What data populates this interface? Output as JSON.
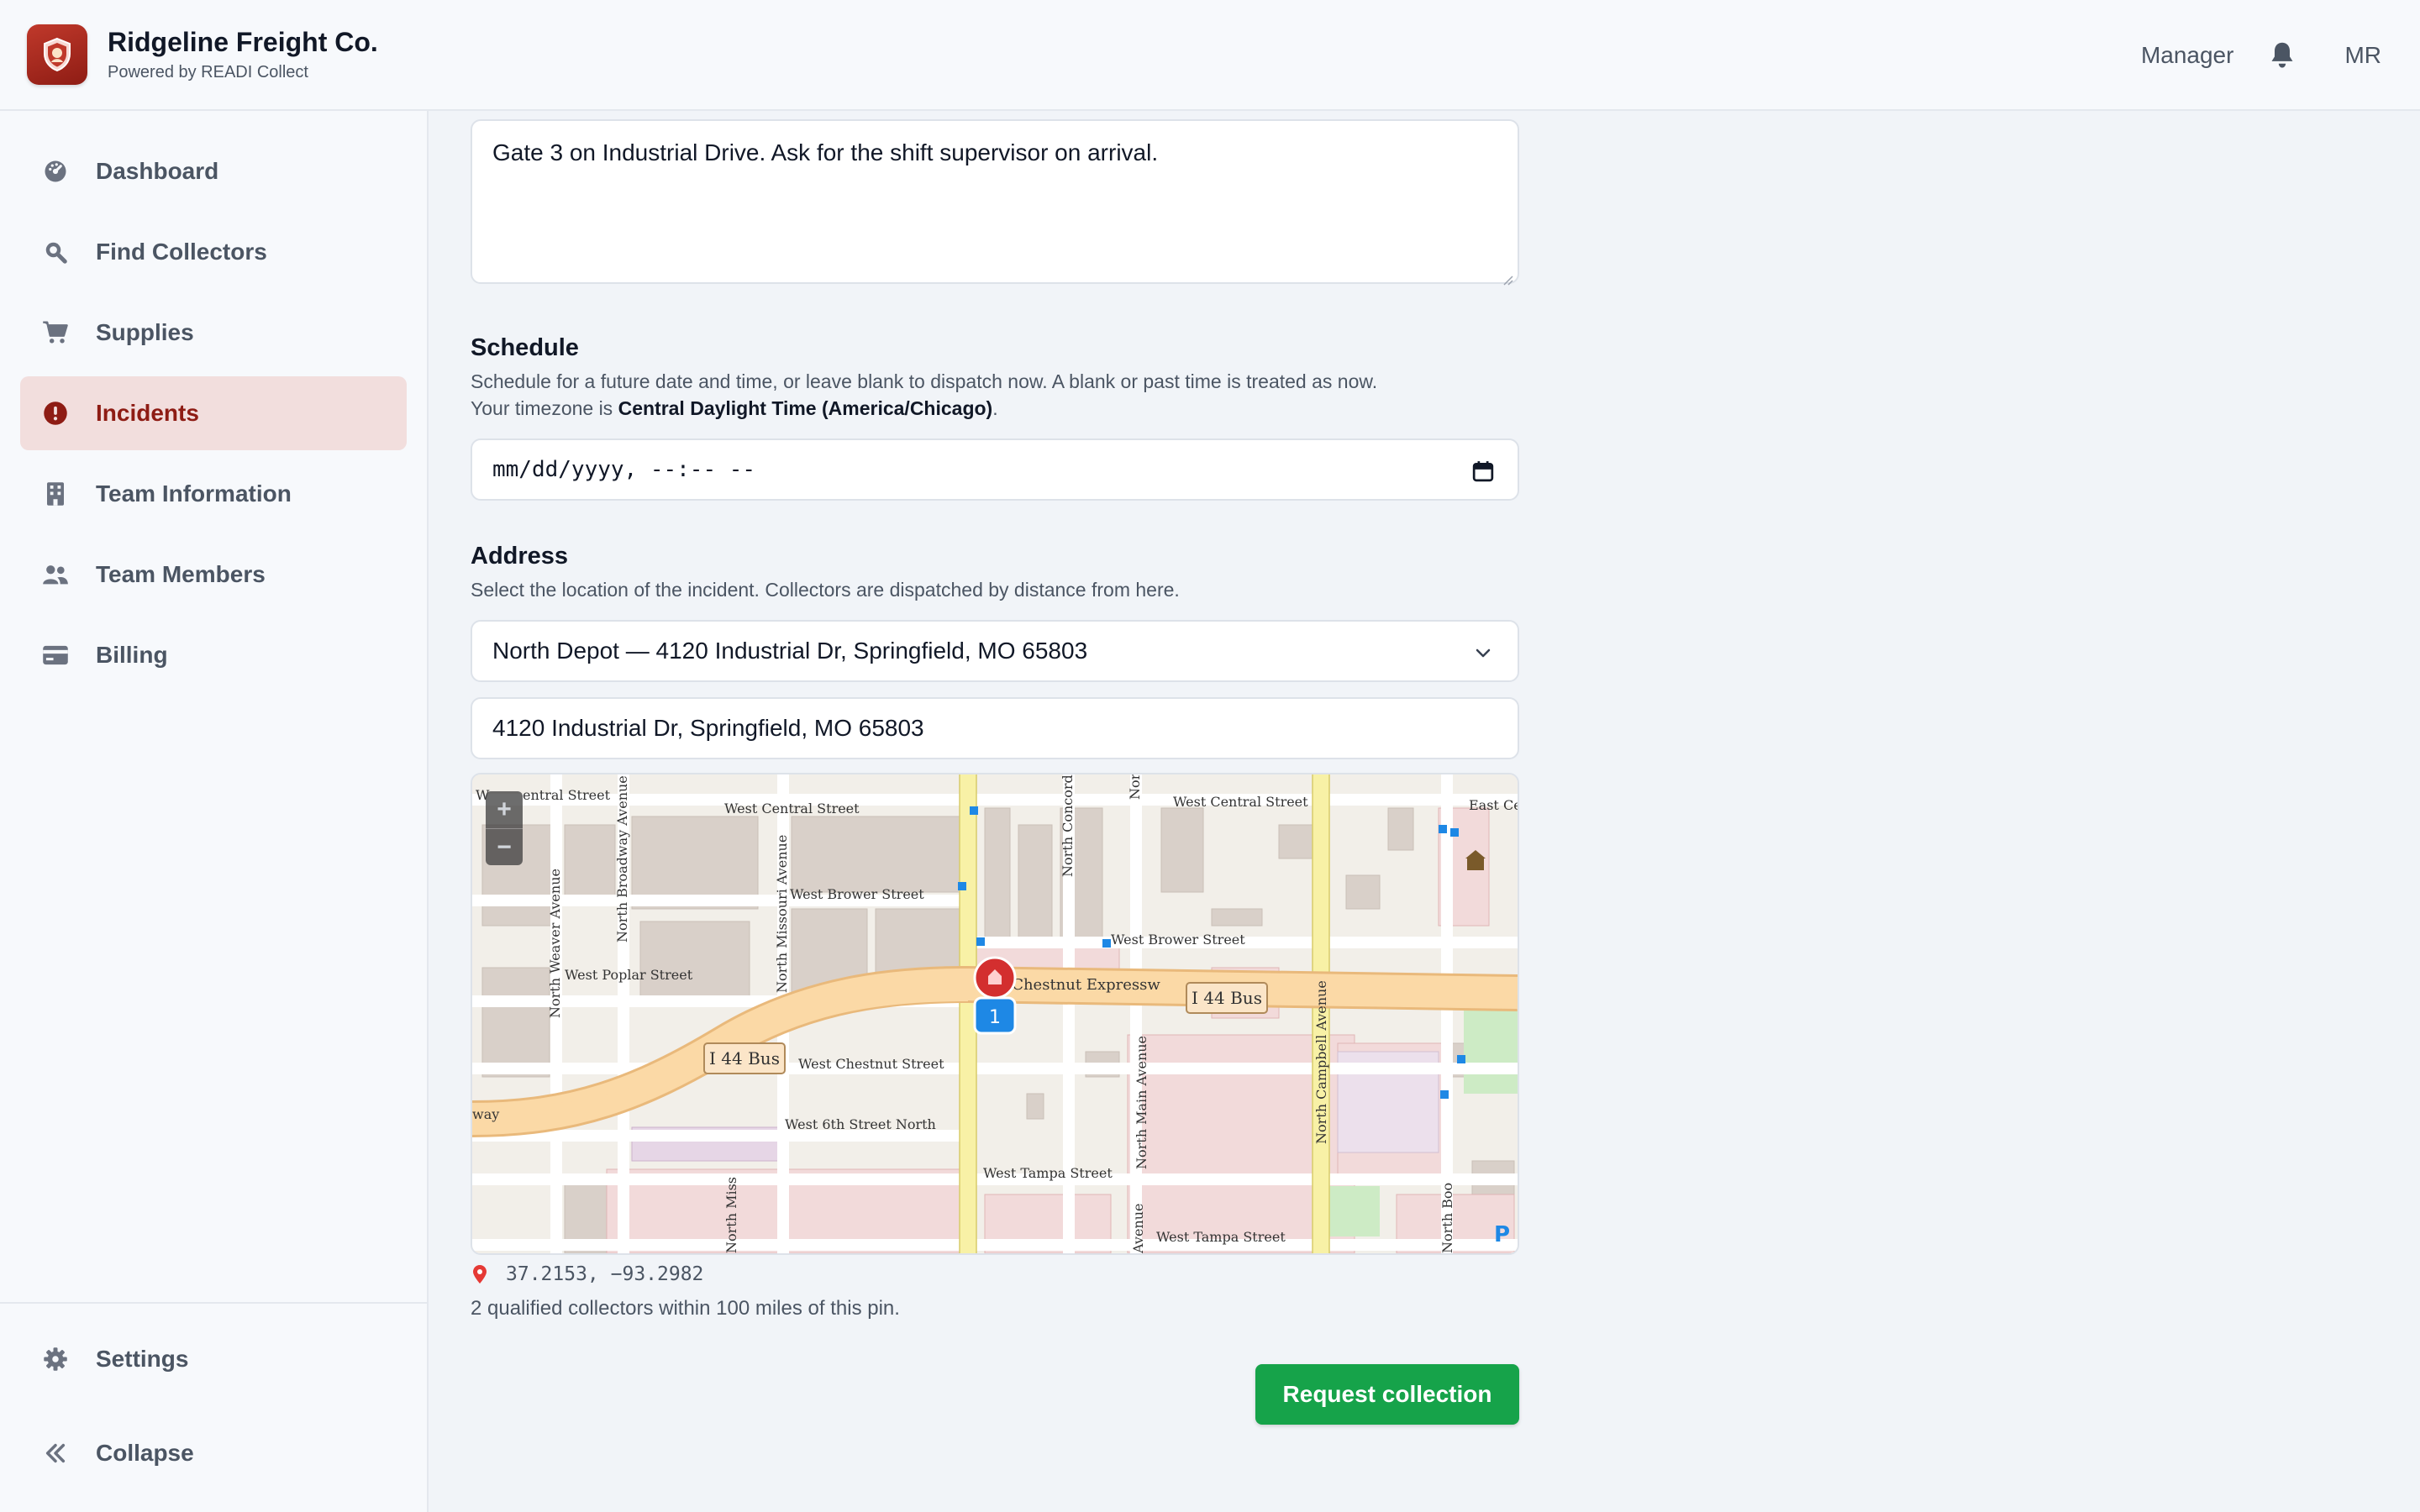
{
  "app": {
    "name": "Ridgeline Freight Co.",
    "powered_by": "Powered by READI Collect",
    "brand_color": "#8e1c14"
  },
  "header": {
    "role": "Manager",
    "notification_icon": "bell-icon",
    "user_initials": "MR"
  },
  "sidebar": {
    "items": [
      {
        "label": "Dashboard",
        "icon": "dashboard-icon",
        "active": false
      },
      {
        "label": "Find Collectors",
        "icon": "search-icon",
        "active": false
      },
      {
        "label": "Supplies",
        "icon": "cart-icon",
        "active": false
      },
      {
        "label": "Incidents",
        "icon": "alert-icon",
        "active": true
      },
      {
        "label": "Team Information",
        "icon": "building-icon",
        "active": false
      },
      {
        "label": "Team Members",
        "icon": "users-icon",
        "active": false
      },
      {
        "label": "Billing",
        "icon": "credit-card-icon",
        "active": false
      }
    ],
    "bottom": [
      {
        "label": "Settings",
        "icon": "gear-icon"
      },
      {
        "label": "Collapse",
        "icon": "double-chevron-left-icon"
      }
    ]
  },
  "form": {
    "notes_value": "Gate 3 on Industrial Drive. Ask for the shift supervisor on arrival.",
    "schedule": {
      "title": "Schedule",
      "help_line1": "Schedule for a future date and time, or leave blank to dispatch now. A blank or past time is treated as now.",
      "help_line2_prefix": "Your timezone is ",
      "timezone": "Central Daylight Time (America/Chicago)",
      "help_line2_suffix": ".",
      "placeholder": "mm/dd/yyyy, --:-- --"
    },
    "address": {
      "title": "Address",
      "help": "Select the location of the incident. Collectors are dispatched by distance from here.",
      "selected_location": "North Depot — 4120 Industrial Dr, Springfield, MO 65803",
      "address_value": "4120 Industrial Dr, Springfield, MO 65803"
    },
    "map": {
      "zoom_in": "+",
      "zoom_out": "−",
      "cluster_count": "1",
      "labels": {
        "central_w": "West Central Street",
        "central_w2": "West Central Street",
        "central_e": "West Central Street",
        "east_central": "East Ce",
        "w_central_left": "W",
        "w_central_left2": "entral Street",
        "brower_w": "West Brower Street",
        "brower_e": "West Brower Street",
        "poplar": "West Poplar Street",
        "chestnut_expwy": "st Chestnut Expressw",
        "i44_right": "I 44 Bus",
        "i44_left": "I 44 Bus",
        "chestnut_st": "West Chestnut Street",
        "sixth": "West 6th Street North",
        "tampa_w": "West Tampa Street",
        "tampa_e": "West Tampa Street",
        "weaver": "North Weaver Avenue",
        "broadway": "North Broadway Avenue",
        "missouri": "North Missouri Avenue",
        "concord": "North Concord",
        "nor": "Nor",
        "main_ave": "North Main Avenue",
        "campbell": "North Campbell Avenue",
        "boo": "North Boo",
        "miss_short": "North Miss",
        "avenue_short": "Avenue",
        "way": "way",
        "parking": "P"
      }
    },
    "coordinates": "37.2153, −93.2982",
    "collectors_note": "2 qualified collectors within 100 miles of this pin.",
    "submit_label": "Request collection",
    "submit_color": "#16a34a"
  }
}
